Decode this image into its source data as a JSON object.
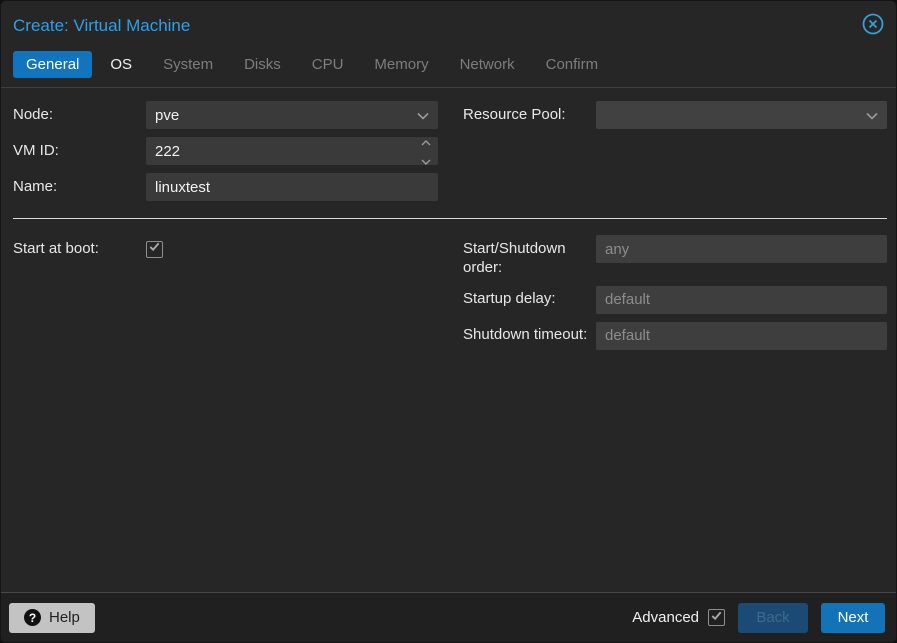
{
  "dialog": {
    "title": "Create: Virtual Machine",
    "close_icon": "circled-x"
  },
  "tabs": [
    {
      "label": "General",
      "state": "active"
    },
    {
      "label": "OS",
      "state": "enabled"
    },
    {
      "label": "System",
      "state": "disabled"
    },
    {
      "label": "Disks",
      "state": "disabled"
    },
    {
      "label": "CPU",
      "state": "disabled"
    },
    {
      "label": "Memory",
      "state": "disabled"
    },
    {
      "label": "Network",
      "state": "disabled"
    },
    {
      "label": "Confirm",
      "state": "disabled"
    }
  ],
  "form": {
    "node": {
      "label": "Node:",
      "value": "pve",
      "control": "combobox"
    },
    "vmid": {
      "label": "VM ID:",
      "value": "222",
      "control": "spinner"
    },
    "name": {
      "label": "Name:",
      "value": "linuxtest",
      "control": "text"
    },
    "resource_pool": {
      "label": "Resource Pool:",
      "value": "",
      "control": "combobox"
    },
    "start_at_boot": {
      "label": "Start at boot:",
      "checked": true
    },
    "startshutdown_order": {
      "label": "Start/Shutdown order:",
      "placeholder": "any",
      "value": ""
    },
    "startup_delay": {
      "label": "Startup delay:",
      "placeholder": "default",
      "value": ""
    },
    "shutdown_timeout": {
      "label": "Shutdown timeout:",
      "placeholder": "default",
      "value": ""
    }
  },
  "footer": {
    "help_label": "Help",
    "advanced_label": "Advanced",
    "advanced_checked": true,
    "back_label": "Back",
    "back_enabled": false,
    "next_label": "Next",
    "next_enabled": true
  },
  "icons": {
    "close-icon": "circle with x",
    "chevron-down-icon": "v",
    "spinner-up-icon": "^",
    "spinner-down-icon": "v",
    "help-icon": "? in dark circle",
    "checkbox-check-icon": "check mark"
  },
  "colors": {
    "dialog_background": "#262626",
    "title_text": "#2e9fe8",
    "active_tab_background": "#1174bc",
    "field_background": "#3a3a3a",
    "placeholder_text": "#8c8c8c",
    "separator_line": "#d8d8d8",
    "footer_background": "#202020",
    "next_button": "#1373b8",
    "back_button": "#1b4b74",
    "help_button": "#c3c3c3"
  }
}
